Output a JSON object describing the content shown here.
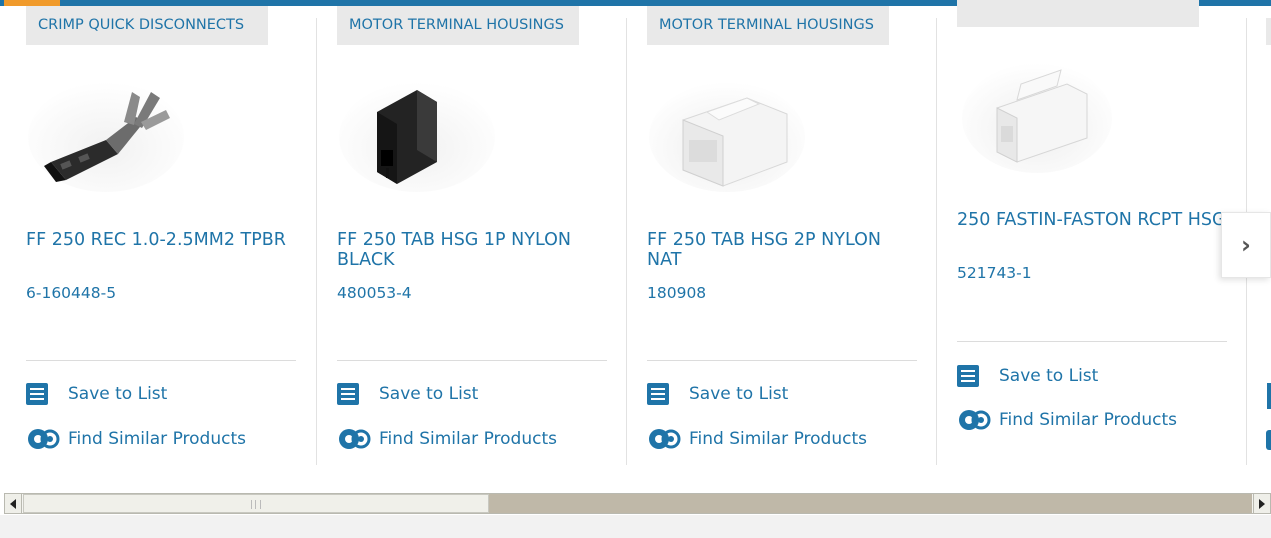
{
  "carousel": {
    "next_label": "›",
    "cards": [
      {
        "category": "CRIMP QUICK DISCONNECTS",
        "title": "FF 250 REC 1.0-2.5MM2 TPBR",
        "part_number": "6-160448-5",
        "save_label": "Save to List",
        "similar_label": "Find Similar Products",
        "image": "crimp-terminal-image"
      },
      {
        "category": "MOTOR TERMINAL HOUSINGS",
        "title": "FF 250 TAB HSG 1P NYLON BLACK",
        "part_number": "480053-4",
        "save_label": "Save to List",
        "similar_label": "Find Similar Products",
        "image": "black-housing-image"
      },
      {
        "category": "MOTOR TERMINAL HOUSINGS",
        "title": "FF 250 TAB HSG 2P NYLON NAT",
        "part_number": "180908",
        "save_label": "Save to List",
        "similar_label": "Find Similar Products",
        "image": "white-2p-housing-image"
      },
      {
        "category": "",
        "title": "250 FASTIN-FASTON RCPT HSG",
        "part_number": "521743-1",
        "save_label": "Save to List",
        "similar_label": "Find Similar Products",
        "image": "white-rcpt-housing-image"
      }
    ]
  },
  "colors": {
    "accent": "#1f74a8",
    "accent_orange": "#f09a2b",
    "category_bg": "#e9e9e9"
  }
}
